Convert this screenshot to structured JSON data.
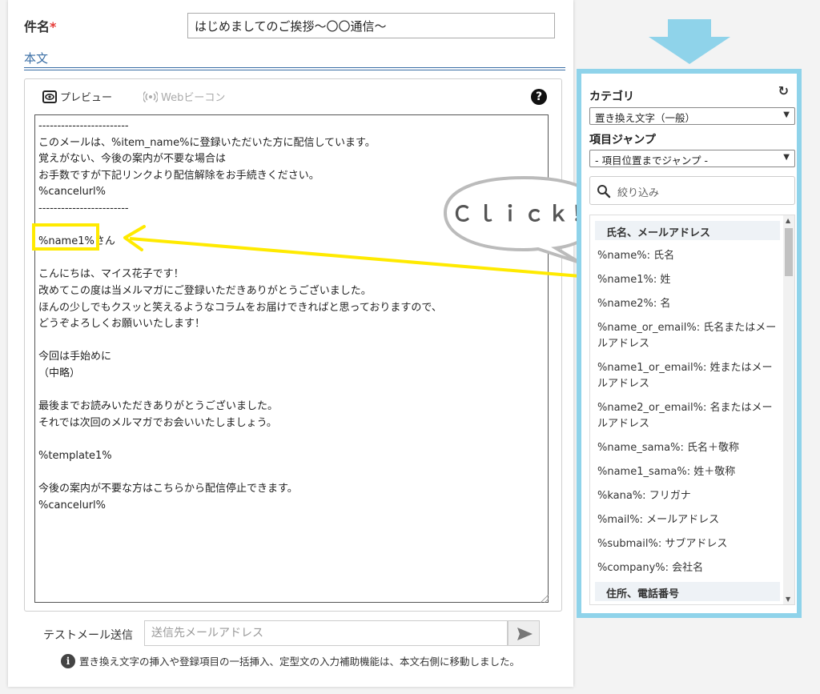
{
  "subject": {
    "label": "件名",
    "required_mark": "*",
    "value": "はじめましてのご挨拶～〇〇通信～"
  },
  "body_label": "本文",
  "toolbar": {
    "preview_label": "プレビュー",
    "beacon_label": "Webビーコン"
  },
  "body_lines": [
    "------------------------",
    "このメールは、%item_name%に登録いただいた方に配信しています。",
    "覚えがない、今後の案内が不要な場合は",
    "お手数ですが下記リンクより配信解除をお手続きください。",
    "%cancelurl%",
    "------------------------",
    "",
    "%name1%さん",
    "",
    "こんにちは、マイス花子です！",
    "改めてこの度は当メルマガにご登録いただきありがとうございました。",
    "ほんの少しでもクスッと笑えるようなコラムをお届けできればと思っておりますので、",
    "どうぞよろしくお願いいたします！",
    "",
    "今回は手始めに",
    "（中略）",
    "",
    "最後までお読みいただきありがとうございました。",
    "それでは次回のメルマガでお会いいたしましょう。",
    "",
    "%template1%",
    "",
    "今後の案内が不要な方はこちらから配信停止できます。",
    "%cancelurl%"
  ],
  "test_mail": {
    "label": "テストメール送信",
    "placeholder": "送信先メールアドレス"
  },
  "info_text": "置き換え文字の挿入や登録項目の一括挿入、定型文の入力補助機能は、本文右側に移動しました。",
  "callout_text": "Ｃｌｉｃｋ！",
  "sidebar": {
    "category_label": "カテゴリ",
    "category_value": "置き換え文字（一般）",
    "jump_label": "項目ジャンプ",
    "jump_value": "- 項目位置までジャンプ -",
    "filter_placeholder": "絞り込み",
    "group1": "氏名、メールアドレス",
    "items": [
      "%name%: 氏名",
      "%name1%: 姓",
      "%name2%: 名",
      "%name_or_email%: 氏名またはメールアドレス",
      "%name1_or_email%: 姓またはメールアドレス",
      "%name2_or_email%: 名またはメールアドレス",
      "%name_sama%: 氏名＋敬称",
      "%name1_sama%: 姓＋敬称",
      "%kana%: フリガナ",
      "%mail%: メールアドレス",
      "%submail%: サブアドレス",
      "%company%: 会社名"
    ],
    "group2": "住所、電話番号"
  },
  "colors": {
    "highlight": "#ffea00",
    "sidebar_border": "#8fd3ea",
    "accent": "#3a6ea5"
  }
}
